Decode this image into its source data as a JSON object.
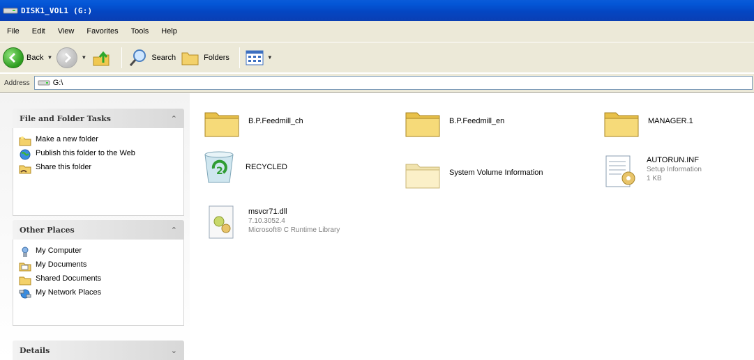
{
  "window": {
    "title": "DISK1_VOL1 (G:)"
  },
  "menu": [
    "File",
    "Edit",
    "View",
    "Favorites",
    "Tools",
    "Help"
  ],
  "toolbar": {
    "back": "Back",
    "search": "Search",
    "folders": "Folders"
  },
  "address": {
    "label": "Address",
    "value": "G:\\"
  },
  "tasks_panel": {
    "title": "File and Folder Tasks",
    "items": [
      "Make a new folder",
      "Publish this folder to the Web",
      "Share this folder"
    ]
  },
  "places_panel": {
    "title": "Other Places",
    "items": [
      "My Computer",
      "My Documents",
      "Shared Documents",
      "My Network Places"
    ]
  },
  "details_panel": {
    "title": "Details"
  },
  "files": [
    {
      "name": "B.P.Feedmill_ch"
    },
    {
      "name": "B.P.Feedmill_en"
    },
    {
      "name": "MANAGER.1"
    },
    {
      "name": "RECYCLED"
    },
    {
      "name": "System Volume Information"
    },
    {
      "name": "AUTORUN.INF",
      "line2": "Setup Information",
      "line3": "1 KB"
    },
    {
      "name": "msvcr71.dll",
      "line2": "7.10.3052.4",
      "line3": "Microsoft® C Runtime Library"
    }
  ]
}
